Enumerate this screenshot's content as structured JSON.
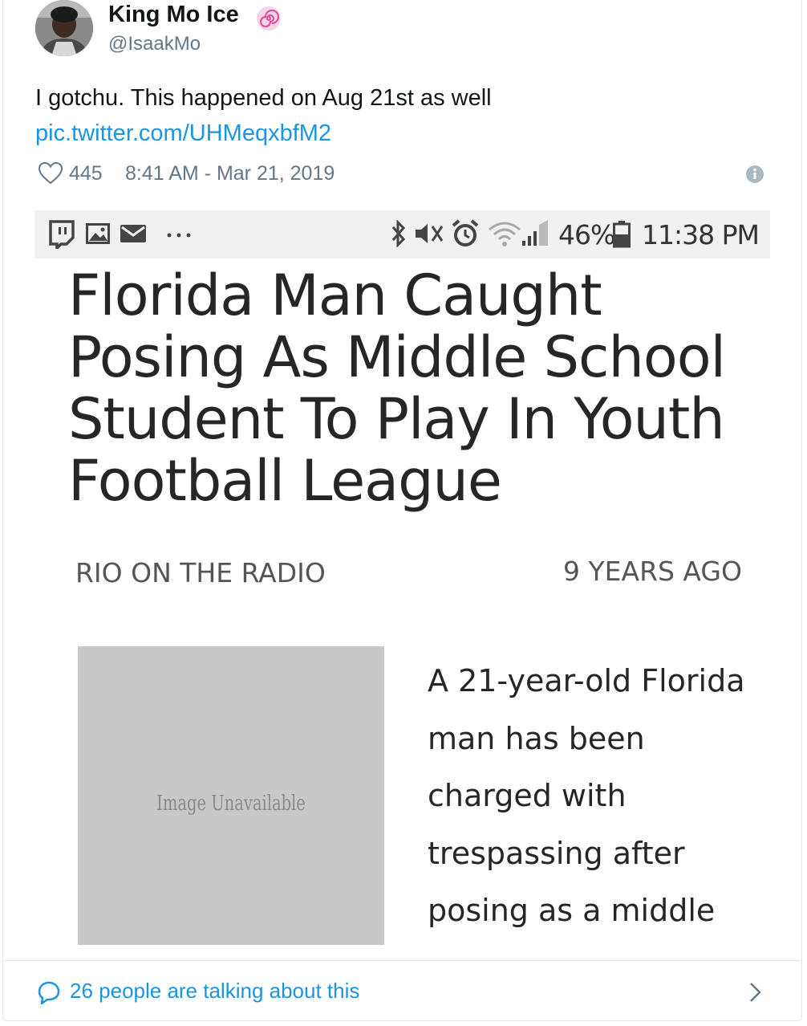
{
  "tweet": {
    "display_name": "King Mo Ice",
    "handle": "@IsaakMo",
    "text": "I gotchu. This happened on Aug 21st as well",
    "link": "pic.twitter.com/UHMeqxbfM2",
    "likes": "445",
    "timestamp": "8:41 AM - Mar 21, 2019"
  },
  "screenshot": {
    "status_bar": {
      "left_icons": [
        "twitch-icon",
        "image-icon",
        "mail-icon",
        "more-icon"
      ],
      "right_icons": [
        "bluetooth-icon",
        "mute-icon",
        "alarm-icon",
        "wifi-icon",
        "signal-icon",
        "battery-icon"
      ],
      "battery": "46%",
      "time": "11:38 PM"
    },
    "article": {
      "headline": "Florida Man Caught Posing As Middle School Student To Play In Youth Football League",
      "source": "RIO ON THE RADIO",
      "age": "9 YEARS AGO",
      "image_placeholder": "Image Unavailable",
      "body_lines": [
        "A 21-year-old Florida",
        "man has been",
        "charged with",
        "trespassing after",
        "posing as a middle"
      ]
    }
  },
  "footer": {
    "talking": "26 people are talking about this"
  },
  "colors": {
    "link": "#1b95e0",
    "secondary": "#657786",
    "verified_swirl": "#e0499b"
  }
}
